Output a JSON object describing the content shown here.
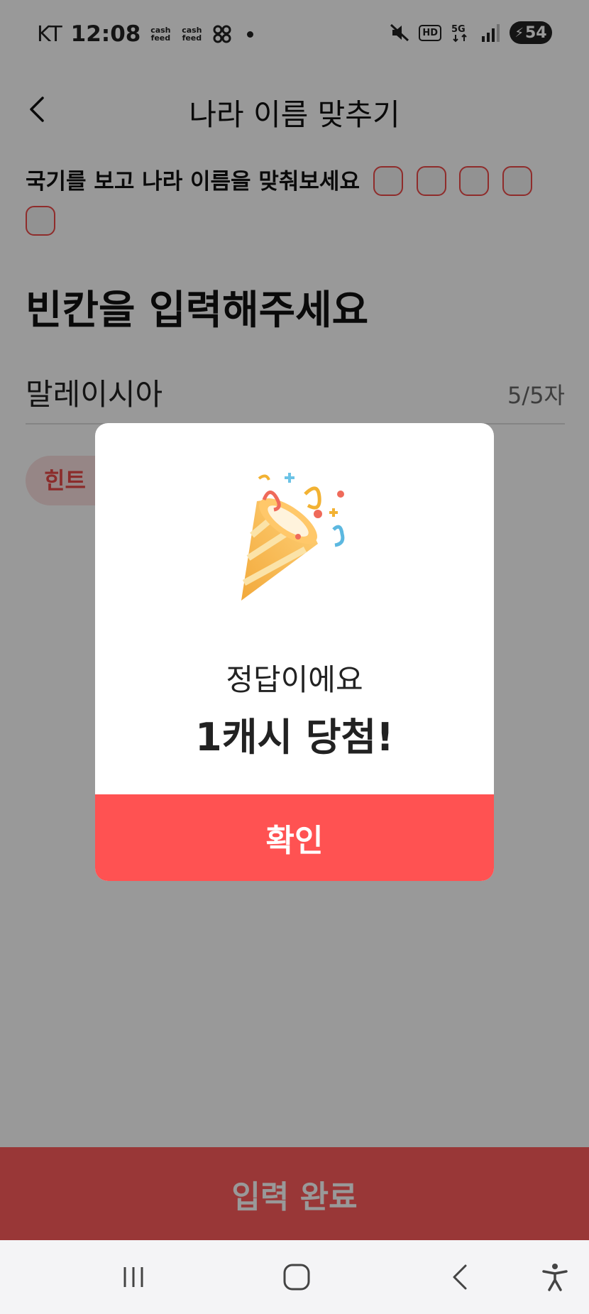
{
  "status_bar": {
    "carrier": "KT",
    "time": "12:08",
    "mini_app_1": "cash\nfeed",
    "mini_app_2": "cash\nfeed",
    "battery": "54"
  },
  "header": {
    "title": "나라 이름 맞추기"
  },
  "quiz": {
    "question": "국기를 보고 나라 이름을 맞춰보세요",
    "reward_box_count": 5,
    "instruction": "빈칸을 입력해주세요",
    "answer": "말레이시아",
    "char_count": "5/5자",
    "hint_label": "힌트"
  },
  "submit_label": "입력 완료",
  "modal": {
    "message": "정답이에요",
    "prize": "1캐시 당첨!",
    "confirm_label": "확인"
  },
  "colors": {
    "accent": "#ff5252",
    "reward_border": "#ef4a48"
  }
}
